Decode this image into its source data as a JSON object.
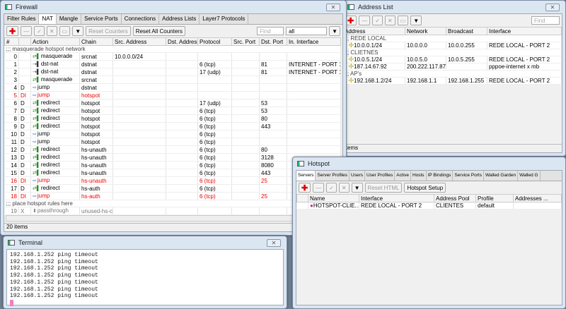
{
  "firewall": {
    "title": "Firewall",
    "tabs": [
      "Filter Rules",
      "NAT",
      "Mangle",
      "Service Ports",
      "Connections",
      "Address Lists",
      "Layer7 Protocols"
    ],
    "active_tab": "NAT",
    "toolbar": {
      "reset_counters": "Reset Counters",
      "reset_all_counters": "Reset All Counters",
      "find_placeholder": "Find",
      "filter_value": "all"
    },
    "columns": [
      "#",
      "",
      "Action",
      "Chain",
      "Src. Address",
      "Dst. Address",
      "Protocol",
      "Src. Port",
      "Dst. Port",
      "In. Interface"
    ],
    "rows": [
      {
        "comment": ";;; masquerade hotspot network"
      },
      {
        "n": "0",
        "f": "",
        "icon": "r",
        "action": "masquerade",
        "chain": "srcnat",
        "src": "10.0.0.0/24",
        "dst": "",
        "proto": "",
        "sport": "",
        "dport": "",
        "iface": ""
      },
      {
        "n": "1",
        "f": "",
        "icon": "d",
        "action": "dst-nat",
        "chain": "dstnat",
        "src": "",
        "dst": "",
        "proto": "6 (tcp)",
        "sport": "",
        "dport": "81",
        "iface": "INTERNET - PORT 1"
      },
      {
        "n": "2",
        "f": "",
        "icon": "d",
        "action": "dst-nat",
        "chain": "dstnat",
        "src": "",
        "dst": "",
        "proto": "17 (udp)",
        "sport": "",
        "dport": "81",
        "iface": "INTERNET - PORT 1"
      },
      {
        "n": "3",
        "f": "",
        "icon": "r",
        "action": "masquerade",
        "chain": "srcnat",
        "src": "",
        "dst": "",
        "proto": "",
        "sport": "",
        "dport": "",
        "iface": ""
      },
      {
        "n": "4",
        "f": "D",
        "icon": "j",
        "action": "jump",
        "chain": "dstnat",
        "src": "",
        "dst": "",
        "proto": "",
        "sport": "",
        "dport": "",
        "iface": ""
      },
      {
        "n": "5",
        "f": "DI",
        "icon": "j",
        "action": "jump",
        "chain": "hotspot",
        "src": "",
        "dst": "",
        "proto": "",
        "sport": "",
        "dport": "",
        "iface": "",
        "state": "red"
      },
      {
        "n": "6",
        "f": "D",
        "icon": "r",
        "action": "redirect",
        "chain": "hotspot",
        "src": "",
        "dst": "",
        "proto": "17 (udp)",
        "sport": "",
        "dport": "53",
        "iface": ""
      },
      {
        "n": "7",
        "f": "D",
        "icon": "r",
        "action": "redirect",
        "chain": "hotspot",
        "src": "",
        "dst": "",
        "proto": "6 (tcp)",
        "sport": "",
        "dport": "53",
        "iface": ""
      },
      {
        "n": "8",
        "f": "D",
        "icon": "r",
        "action": "redirect",
        "chain": "hotspot",
        "src": "",
        "dst": "",
        "proto": "6 (tcp)",
        "sport": "",
        "dport": "80",
        "iface": ""
      },
      {
        "n": "9",
        "f": "D",
        "icon": "r",
        "action": "redirect",
        "chain": "hotspot",
        "src": "",
        "dst": "",
        "proto": "6 (tcp)",
        "sport": "",
        "dport": "443",
        "iface": ""
      },
      {
        "n": "10",
        "f": "D",
        "icon": "j",
        "action": "jump",
        "chain": "hotspot",
        "src": "",
        "dst": "",
        "proto": "6 (tcp)",
        "sport": "",
        "dport": "",
        "iface": ""
      },
      {
        "n": "11",
        "f": "D",
        "icon": "j",
        "action": "jump",
        "chain": "hotspot",
        "src": "",
        "dst": "",
        "proto": "6 (tcp)",
        "sport": "",
        "dport": "",
        "iface": ""
      },
      {
        "n": "12",
        "f": "D",
        "icon": "r",
        "action": "redirect",
        "chain": "hs-unauth",
        "src": "",
        "dst": "",
        "proto": "6 (tcp)",
        "sport": "",
        "dport": "80",
        "iface": ""
      },
      {
        "n": "13",
        "f": "D",
        "icon": "r",
        "action": "redirect",
        "chain": "hs-unauth",
        "src": "",
        "dst": "",
        "proto": "6 (tcp)",
        "sport": "",
        "dport": "3128",
        "iface": ""
      },
      {
        "n": "14",
        "f": "D",
        "icon": "r",
        "action": "redirect",
        "chain": "hs-unauth",
        "src": "",
        "dst": "",
        "proto": "6 (tcp)",
        "sport": "",
        "dport": "8080",
        "iface": ""
      },
      {
        "n": "15",
        "f": "D",
        "icon": "r",
        "action": "redirect",
        "chain": "hs-unauth",
        "src": "",
        "dst": "",
        "proto": "6 (tcp)",
        "sport": "",
        "dport": "443",
        "iface": ""
      },
      {
        "n": "16",
        "f": "DI",
        "icon": "j",
        "action": "jump",
        "chain": "hs-unauth",
        "src": "",
        "dst": "",
        "proto": "6 (tcp)",
        "sport": "",
        "dport": "25",
        "iface": "",
        "state": "red"
      },
      {
        "n": "17",
        "f": "D",
        "icon": "r",
        "action": "redirect",
        "chain": "hs-auth",
        "src": "",
        "dst": "",
        "proto": "6 (tcp)",
        "sport": "",
        "dport": "",
        "iface": ""
      },
      {
        "n": "18",
        "f": "DI",
        "icon": "j",
        "action": "jump",
        "chain": "hs-auth",
        "src": "",
        "dst": "",
        "proto": "6 (tcp)",
        "sport": "",
        "dport": "25",
        "iface": "",
        "state": "red"
      },
      {
        "comment": ";;; place hotspot rules here"
      },
      {
        "n": "19",
        "f": "X",
        "icon": "p",
        "action": "passthrough",
        "chain": "unused-hs-c...",
        "src": "",
        "dst": "",
        "proto": "",
        "sport": "",
        "dport": "",
        "iface": "",
        "state": "gray"
      }
    ],
    "status": "20 items"
  },
  "address_list": {
    "title": "Address List",
    "find_placeholder": "Find",
    "columns": [
      "Address",
      "Network",
      "Broadcast",
      "Interface"
    ],
    "rows": [
      {
        "comment": ";;; REDE LOCAL"
      },
      {
        "address": "10.0.0.1/24",
        "network": "10.0.0.0",
        "broadcast": "10.0.0.255",
        "iface": "REDE LOCAL - PORT 2"
      },
      {
        "comment": ";;; CLIETNES"
      },
      {
        "address": "10.0.5.1/24",
        "network": "10.0.5.0",
        "broadcast": "10.0.5.255",
        "iface": "REDE LOCAL - PORT 2"
      },
      {
        "address": "187.14.67.92",
        "network": "200.222.117.87",
        "broadcast": "",
        "iface": "pppoe-internet x mb"
      },
      {
        "comment": ";;; AP's"
      },
      {
        "address": "192.168.1.2/24",
        "network": "192.168.1.1",
        "broadcast": "192.168.1.255",
        "iface": "REDE LOCAL - PORT 2"
      }
    ],
    "status": "items"
  },
  "hotspot": {
    "title": "Hotspot",
    "tabs": [
      "Servers",
      "Server Profiles",
      "Users",
      "User Profiles",
      "Active",
      "Hosts",
      "IP Bindings",
      "Service Ports",
      "Walled Garden",
      "Walled G"
    ],
    "active_tab": "Servers",
    "toolbar": {
      "reset_html": "Reset HTML",
      "hotspot_setup": "Hotspot Setup"
    },
    "columns": [
      "Name",
      "Interface",
      "Address Pool",
      "Profile",
      "Addresses ..."
    ],
    "rows": [
      {
        "name": "HOTSPOT-CLIE...",
        "iface": "REDE LOCAL - PORT 2",
        "pool": "CLIENTES",
        "profile": "default",
        "addresses": ""
      }
    ]
  },
  "terminal": {
    "title": "Terminal",
    "lines": [
      "192.168.1.252 ping timeout",
      "192.168.1.252 ping timeout",
      "192.168.1.252 ping timeout",
      "192.168.1.252 ping timeout",
      "192.168.1.252 ping timeout",
      "192.168.1.252 ping timeout",
      "192.168.1.252 ping timeout"
    ]
  }
}
